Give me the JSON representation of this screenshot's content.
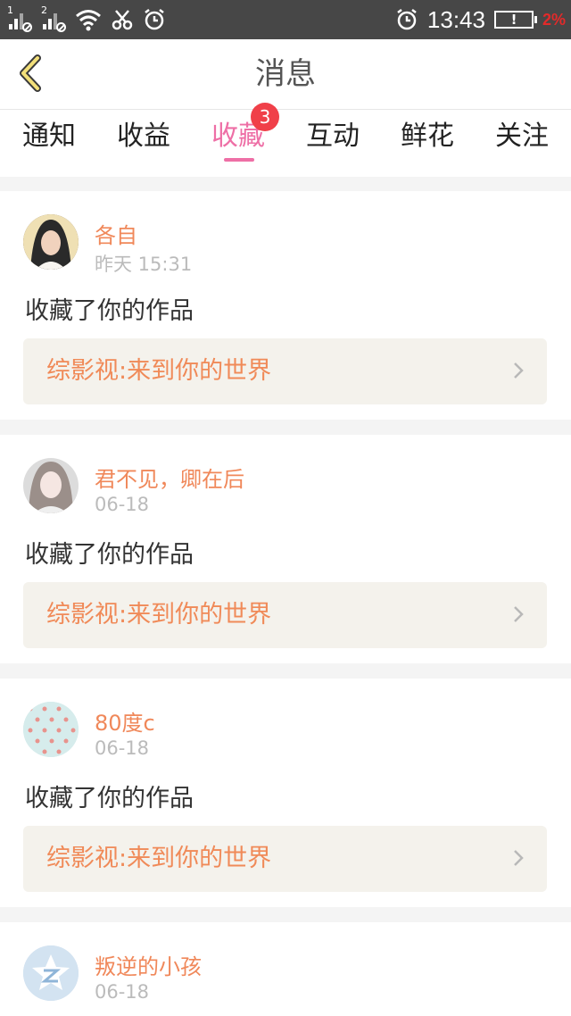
{
  "status_bar": {
    "sim1": "1",
    "sim2": "2",
    "time": "13:43",
    "battery_glyph": "!",
    "battery_percent": "2%",
    "icons": [
      "signal-icon",
      "signal-icon",
      "wifi-icon",
      "scissors-icon",
      "alarm-icon",
      "alarm-icon",
      "battery-icon"
    ]
  },
  "nav": {
    "title": "消息",
    "back_icon": "back-arrow-icon"
  },
  "tabs": [
    {
      "label": "通知",
      "active": false
    },
    {
      "label": "收益",
      "active": false
    },
    {
      "label": "收藏",
      "active": true,
      "badge": "3"
    },
    {
      "label": "互动",
      "active": false
    },
    {
      "label": "鲜花",
      "active": false
    },
    {
      "label": "关注",
      "active": false
    }
  ],
  "colors": {
    "accent": "#ee6fa6",
    "username": "#f0885a",
    "badge": "#f04049"
  },
  "messages": [
    {
      "user": "各自",
      "time": "昨天 15:31",
      "action": "收藏了你的作品",
      "work": "综影视:来到你的世界"
    },
    {
      "user": "君不见，卿在后",
      "time": "06-18",
      "action": "收藏了你的作品",
      "work": "综影视:来到你的世界"
    },
    {
      "user": "80度c",
      "time": "06-18",
      "action": "收藏了你的作品",
      "work": "综影视:来到你的世界"
    },
    {
      "user": "叛逆的小孩",
      "time": "06-18"
    }
  ]
}
